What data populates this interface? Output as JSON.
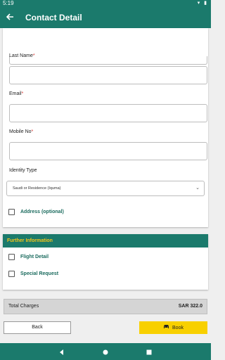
{
  "status_bar": {
    "time": "5:19",
    "icons": "▾ ▮"
  },
  "app_bar": {
    "title": "Contact Detail",
    "back_icon": "arrow-left-icon"
  },
  "form": {
    "last_name": {
      "label": "Last Name",
      "required_mark": "*",
      "value": ""
    },
    "email": {
      "label": "Email",
      "required_mark": "*",
      "value": ""
    },
    "mobile": {
      "label": "Mobile No",
      "required_mark": "*",
      "value": ""
    },
    "identity_type": {
      "label": "Identity Type",
      "selected": "Saudi or Residence (Iquma)"
    },
    "address": {
      "label": "Address (optional)",
      "checked": false
    }
  },
  "further_information": {
    "title": "Further Information",
    "items": [
      {
        "label": "Flight Detail",
        "checked": false
      },
      {
        "label": "Special Request",
        "checked": false
      }
    ]
  },
  "total": {
    "label": "Total Charges",
    "amount": "SAR 322.0"
  },
  "buttons": {
    "back": "Back",
    "book": "Book"
  },
  "colors": {
    "primary": "#1b7a6c",
    "accent": "#f8d000",
    "header_text": "#f5c518",
    "required": "#d9322e"
  }
}
